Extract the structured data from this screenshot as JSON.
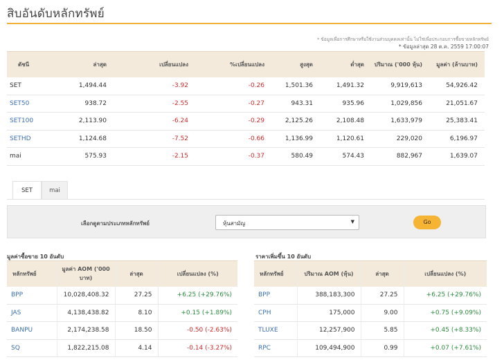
{
  "page_title": "สิบอันดับหลักทรัพย์",
  "notes": {
    "disclaimer": "* ข้อมูลเพื่อการศึกษาหรือใช้งานส่วนบุคคลเท่านั้น ไม่ใช่เพื่อประกอบการซื้อขายหลักทรัพย์",
    "updated": "* ข้อมูลล่าสุด 28 ต.ค. 2559 17:00:07"
  },
  "index_table": {
    "headers": [
      "ดัชนี",
      "ล่าสุด",
      "เปลี่ยนแปลง",
      "%เปลี่ยนแปลง",
      "สูงสุด",
      "ต่ำสุด",
      "ปริมาณ ('000 หุ้น)",
      "มูลค่า (ล้านบาท)"
    ],
    "rows": [
      {
        "name": "SET",
        "last": "1,494.44",
        "change": "-3.92",
        "pct": "-0.26",
        "high": "1,501.36",
        "low": "1,491.32",
        "volume": "9,919,613",
        "value": "54,926.42"
      },
      {
        "name": "SET50",
        "last": "938.72",
        "change": "-2.55",
        "pct": "-0.27",
        "high": "943.31",
        "low": "935.96",
        "volume": "1,029,856",
        "value": "21,051.67"
      },
      {
        "name": "SET100",
        "last": "2,113.90",
        "change": "-6.24",
        "pct": "-0.29",
        "high": "2,125.26",
        "low": "2,108.48",
        "volume": "1,633,979",
        "value": "25,383.41"
      },
      {
        "name": "SETHD",
        "last": "1,124.68",
        "change": "-7.52",
        "pct": "-0.66",
        "high": "1,136.99",
        "low": "1,120.61",
        "volume": "229,020",
        "value": "6,196.97"
      },
      {
        "name": "mai",
        "last": "575.93",
        "change": "-2.15",
        "pct": "-0.37",
        "high": "580.49",
        "low": "574.43",
        "volume": "882,967",
        "value": "1,639.07"
      }
    ]
  },
  "tabs": [
    {
      "label": "SET",
      "active": true
    },
    {
      "label": "mai",
      "active": false
    }
  ],
  "filter": {
    "label": "เลือกดูตามประเภทหลักทรัพย์",
    "selected": "หุ้นสามัญ",
    "go_label": "Go"
  },
  "top_value": {
    "title": "มูลค่าซื้อขาย 10 อันดับ",
    "headers": [
      "หลักทรัพย์",
      "มูลค่า AOM ('000 บาท)",
      "ล่าสุด",
      "เปลี่ยนแปลง (%)"
    ],
    "rows": [
      {
        "symbol": "BPP",
        "amount": "10,028,408.32",
        "last": "27.25",
        "change": "+6.25 (+29.76%)"
      },
      {
        "symbol": "JAS",
        "amount": "4,138,438.82",
        "last": "8.10",
        "change": "+0.15 (+1.89%)"
      },
      {
        "symbol": "BANPU",
        "amount": "2,174,238.58",
        "last": "18.50",
        "change": "-0.50 (-2.63%)"
      },
      {
        "symbol": "SQ",
        "amount": "1,822,215.08",
        "last": "4.14",
        "change": "-0.14 (-3.27%)"
      }
    ]
  },
  "top_gainers": {
    "title": "ราคาเพิ่มขึ้น 10 อันดับ",
    "headers": [
      "หลักทรัพย์",
      "ปริมาณ AOM (หุ้น)",
      "ล่าสุด",
      "เปลี่ยนแปลง (%)"
    ],
    "rows": [
      {
        "symbol": "BPP",
        "amount": "388,183,300",
        "last": "27.25",
        "change": "+6.25 (+29.76%)"
      },
      {
        "symbol": "CPH",
        "amount": "175,000",
        "last": "9.00",
        "change": "+0.75 (+9.09%)"
      },
      {
        "symbol": "TLUXE",
        "amount": "12,257,900",
        "last": "5.85",
        "change": "+0.45 (+8.33%)"
      },
      {
        "symbol": "RPC",
        "amount": "109,494,900",
        "last": "0.99",
        "change": "+0.07 (+7.61%)"
      }
    ]
  },
  "colors": {
    "accent": "#f0b13c",
    "negative": "#cc2a2a",
    "positive": "#2b8a3e",
    "link": "#3a6fb0",
    "header_bg": "#f3eadc"
  }
}
